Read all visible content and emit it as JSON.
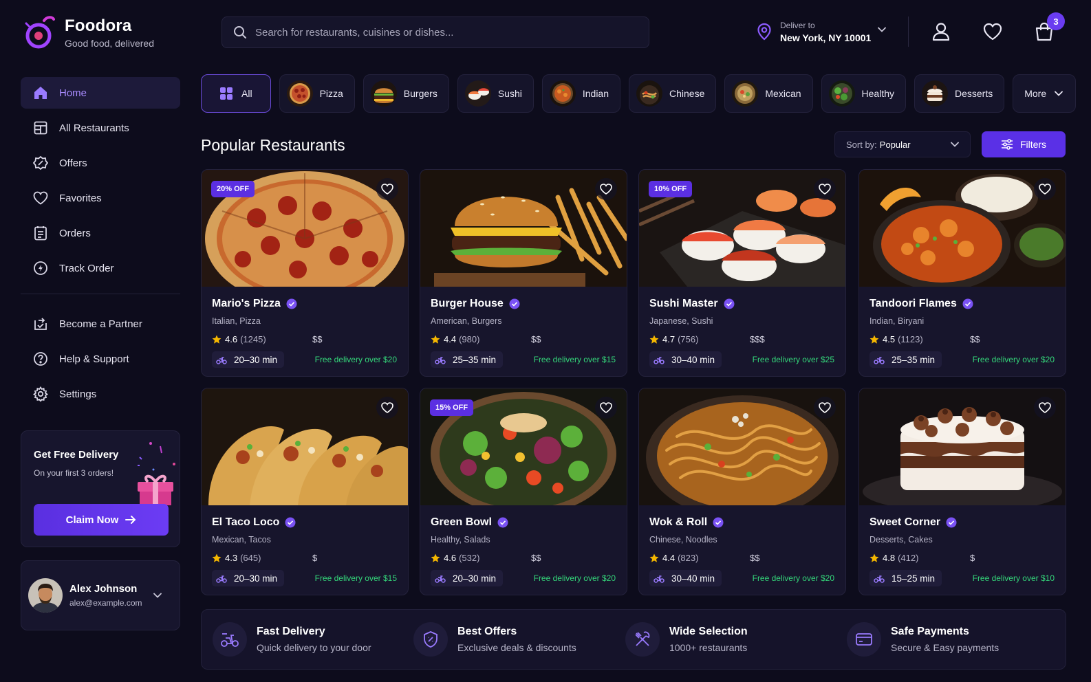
{
  "brand": {
    "name": "Foodora",
    "tagline": "Good food, delivered"
  },
  "search": {
    "placeholder": "Search for restaurants, cuisines or dishes..."
  },
  "location": {
    "label": "Deliver to",
    "value": "New York, NY 10001"
  },
  "cart": {
    "count": "3"
  },
  "sidebar": {
    "items": [
      {
        "label": "Home",
        "icon": "home-icon",
        "active": true
      },
      {
        "label": "All Restaurants",
        "icon": "store-icon"
      },
      {
        "label": "Offers",
        "icon": "tag-icon"
      },
      {
        "label": "Favorites",
        "icon": "heart-icon"
      },
      {
        "label": "Orders",
        "icon": "receipt-icon"
      },
      {
        "label": "Track Order",
        "icon": "track-icon"
      }
    ],
    "secondary": [
      {
        "label": "Become a Partner",
        "icon": "partner-icon"
      },
      {
        "label": "Help & Support",
        "icon": "help-icon"
      },
      {
        "label": "Settings",
        "icon": "gear-icon"
      }
    ]
  },
  "promo": {
    "title": "Get Free Delivery",
    "subtitle": "On your first 3 orders!",
    "button": "Claim Now"
  },
  "user": {
    "name": "Alex Johnson",
    "email": "alex@example.com"
  },
  "categories": [
    {
      "label": "All"
    },
    {
      "label": "Pizza"
    },
    {
      "label": "Burgers"
    },
    {
      "label": "Sushi"
    },
    {
      "label": "Indian"
    },
    {
      "label": "Chinese"
    },
    {
      "label": "Mexican"
    },
    {
      "label": "Healthy"
    },
    {
      "label": "Desserts"
    },
    {
      "label": "More"
    }
  ],
  "section": {
    "title": "Popular Restaurants"
  },
  "sort": {
    "label": "Sort by:",
    "value": "Popular"
  },
  "filters": {
    "label": "Filters"
  },
  "restaurants": [
    {
      "name": "Mario's Pizza",
      "cuisine": "Italian, Pizza",
      "rating": "4.6",
      "reviews": "(1245)",
      "price": "$$",
      "time": "20–30 min",
      "delivery": "Free delivery over $20",
      "badge": "20% OFF"
    },
    {
      "name": "Burger House",
      "cuisine": "American, Burgers",
      "rating": "4.4",
      "reviews": "(980)",
      "price": "$$",
      "time": "25–35 min",
      "delivery": "Free delivery over $15",
      "badge": ""
    },
    {
      "name": "Sushi Master",
      "cuisine": "Japanese, Sushi",
      "rating": "4.7",
      "reviews": "(756)",
      "price": "$$$",
      "time": "30–40 min",
      "delivery": "Free delivery over $25",
      "badge": "10% OFF"
    },
    {
      "name": "Tandoori Flames",
      "cuisine": "Indian, Biryani",
      "rating": "4.5",
      "reviews": "(1123)",
      "price": "$$",
      "time": "25–35 min",
      "delivery": "Free delivery over $20",
      "badge": ""
    },
    {
      "name": "El Taco Loco",
      "cuisine": "Mexican, Tacos",
      "rating": "4.3",
      "reviews": "(645)",
      "price": "$",
      "time": "20–30 min",
      "delivery": "Free delivery over $15",
      "badge": ""
    },
    {
      "name": "Green Bowl",
      "cuisine": "Healthy, Salads",
      "rating": "4.6",
      "reviews": "(532)",
      "price": "$$",
      "time": "20–30 min",
      "delivery": "Free delivery over $20",
      "badge": "15% OFF"
    },
    {
      "name": "Wok & Roll",
      "cuisine": "Chinese, Noodles",
      "rating": "4.4",
      "reviews": "(823)",
      "price": "$$",
      "time": "30–40 min",
      "delivery": "Free delivery over $20",
      "badge": ""
    },
    {
      "name": "Sweet Corner",
      "cuisine": "Desserts, Cakes",
      "rating": "4.8",
      "reviews": "(412)",
      "price": "$",
      "time": "15–25 min",
      "delivery": "Free delivery over $10",
      "badge": ""
    }
  ],
  "features": [
    {
      "title": "Fast Delivery",
      "subtitle": "Quick delivery to your door",
      "icon": "scooter-icon"
    },
    {
      "title": "Best Offers",
      "subtitle": "Exclusive deals & discounts",
      "icon": "shield-icon"
    },
    {
      "title": "Wide Selection",
      "subtitle": "1000+ restaurants",
      "icon": "utensils-icon"
    },
    {
      "title": "Safe Payments",
      "subtitle": "Secure & Easy payments",
      "icon": "card-icon"
    }
  ],
  "colors": {
    "accent": "#5b2fe2",
    "green": "#34d67a",
    "bg": "#0d0c1c",
    "star": "#f5b700"
  }
}
